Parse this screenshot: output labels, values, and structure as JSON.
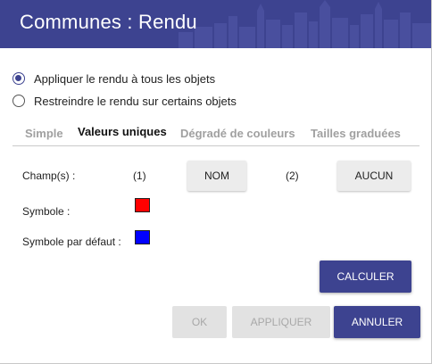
{
  "dialog": {
    "title": "Communes : Rendu"
  },
  "scope": {
    "options": [
      {
        "label": "Appliquer le rendu à tous les objets",
        "checked": true
      },
      {
        "label": "Restreindre le rendu sur certains objets",
        "checked": false
      }
    ]
  },
  "tabs": [
    {
      "label": "Simple",
      "active": false
    },
    {
      "label": "Valeurs uniques",
      "active": true
    },
    {
      "label": "Dégradé de couleurs",
      "active": false
    },
    {
      "label": "Tailles graduées",
      "active": false
    }
  ],
  "form": {
    "fields_label": "Champ(s) :",
    "field1_index": "(1)",
    "field1_button": "NOM",
    "field2_index": "(2)",
    "field2_button": "AUCUN",
    "symbol_label": "Symbole :",
    "symbol_color": "#ff0000",
    "default_symbol_label": "Symbole par défaut :",
    "default_symbol_color": "#0000ff"
  },
  "actions": {
    "calculate": "CALCULER",
    "ok": "OK",
    "apply": "APPLIQUER",
    "cancel": "ANNULER"
  },
  "colors": {
    "header": "#3d4390",
    "primary_button": "#3d4390"
  }
}
